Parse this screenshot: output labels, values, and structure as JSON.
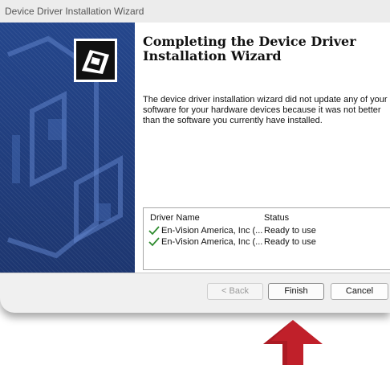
{
  "window": {
    "title": "Device Driver Installation Wizard"
  },
  "wizard": {
    "heading_line1": "Completing the Device Driver",
    "heading_line2": "Installation Wizard",
    "description": "The device driver installation wizard did not update any of your software for your hardware devices because it was not better than the software you currently have installed."
  },
  "driver_table": {
    "columns": [
      "Driver Name",
      "Status"
    ],
    "rows": [
      {
        "name": "En-Vision America, Inc (...",
        "status": "Ready to use"
      },
      {
        "name": "En-Vision America, Inc (...",
        "status": "Ready to use"
      }
    ]
  },
  "buttons": {
    "back": "< Back",
    "finish": "Finish",
    "cancel": "Cancel"
  },
  "colors": {
    "banner": "#1f3a78",
    "check": "#2e8b2e",
    "arrow": "#c0202a"
  }
}
